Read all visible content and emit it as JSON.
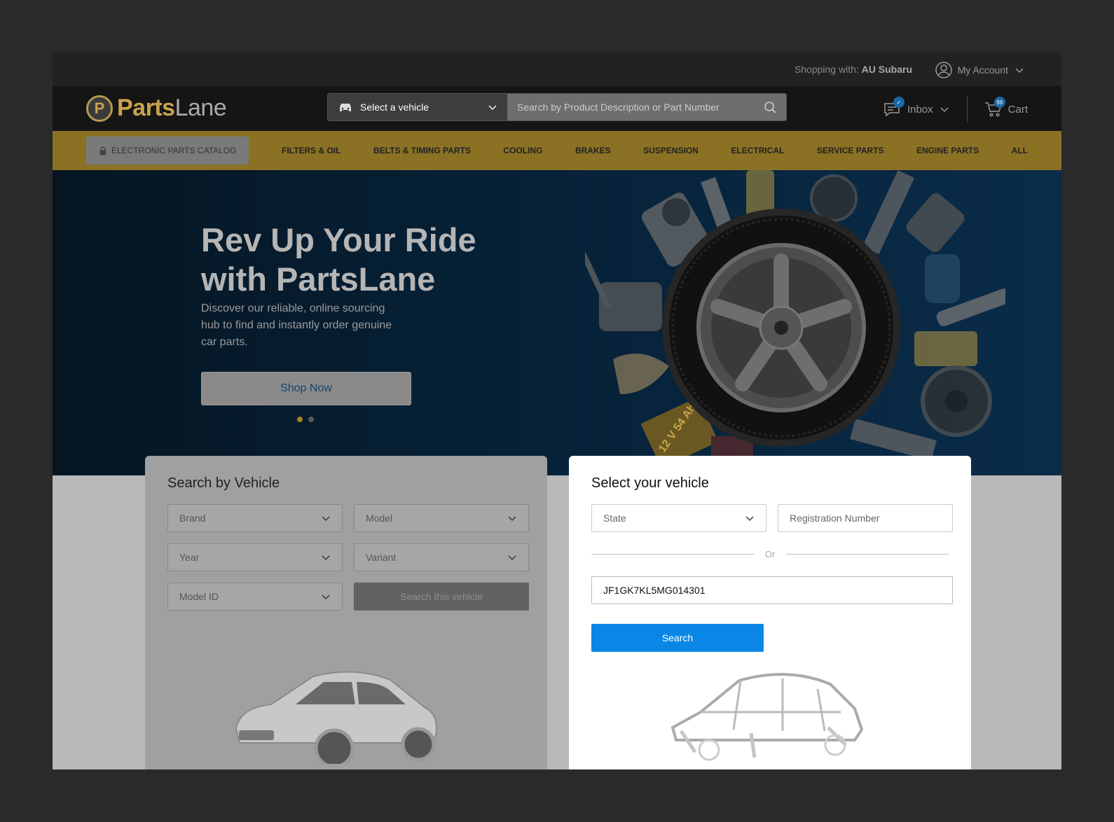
{
  "topbar": {
    "shopping_label": "Shopping with:",
    "shopping_value": "AU Subaru",
    "account_label": "My Account"
  },
  "header": {
    "logo_part1": "Parts",
    "logo_part2": "Lane",
    "vehicle_select_label": "Select a vehicle",
    "search_placeholder": "Search by Product Description or Part Number",
    "inbox_label": "Inbox",
    "cart_label": "Cart",
    "cart_count": "99"
  },
  "nav": {
    "catalog_label": "ELECTRONIC PARTS CATALOG",
    "items": [
      "FILTERS & OIL",
      "BELTS & TIMING PARTS",
      "COOLING",
      "BRAKES",
      "SUSPENSION",
      "ELECTRICAL",
      "SERVICE PARTS",
      "ENGINE PARTS",
      "ALL"
    ]
  },
  "hero": {
    "title_line1": "Rev Up Your Ride",
    "title_line2": "with PartsLane",
    "subtitle": "Discover our reliable, online sourcing hub to find and instantly order genuine car parts.",
    "button_label": "Shop Now",
    "battery_label": "12 V 54 Ah"
  },
  "search_by_vehicle": {
    "title": "Search by Vehicle",
    "brand": "Brand",
    "model": "Model",
    "year": "Year",
    "variant": "Variant",
    "model_id": "Model ID",
    "search_button": "Search this vehicle"
  },
  "select_vehicle": {
    "title": "Select your vehicle",
    "state": "State",
    "registration_placeholder": "Registration Number",
    "or_label": "Or",
    "vin_value": "JF1GK7KL5MG014301",
    "search_button": "Search"
  },
  "colors": {
    "accent_blue": "#0a87e6",
    "nav_gold": "#8a7124",
    "logo_gold": "#c9a34c"
  }
}
